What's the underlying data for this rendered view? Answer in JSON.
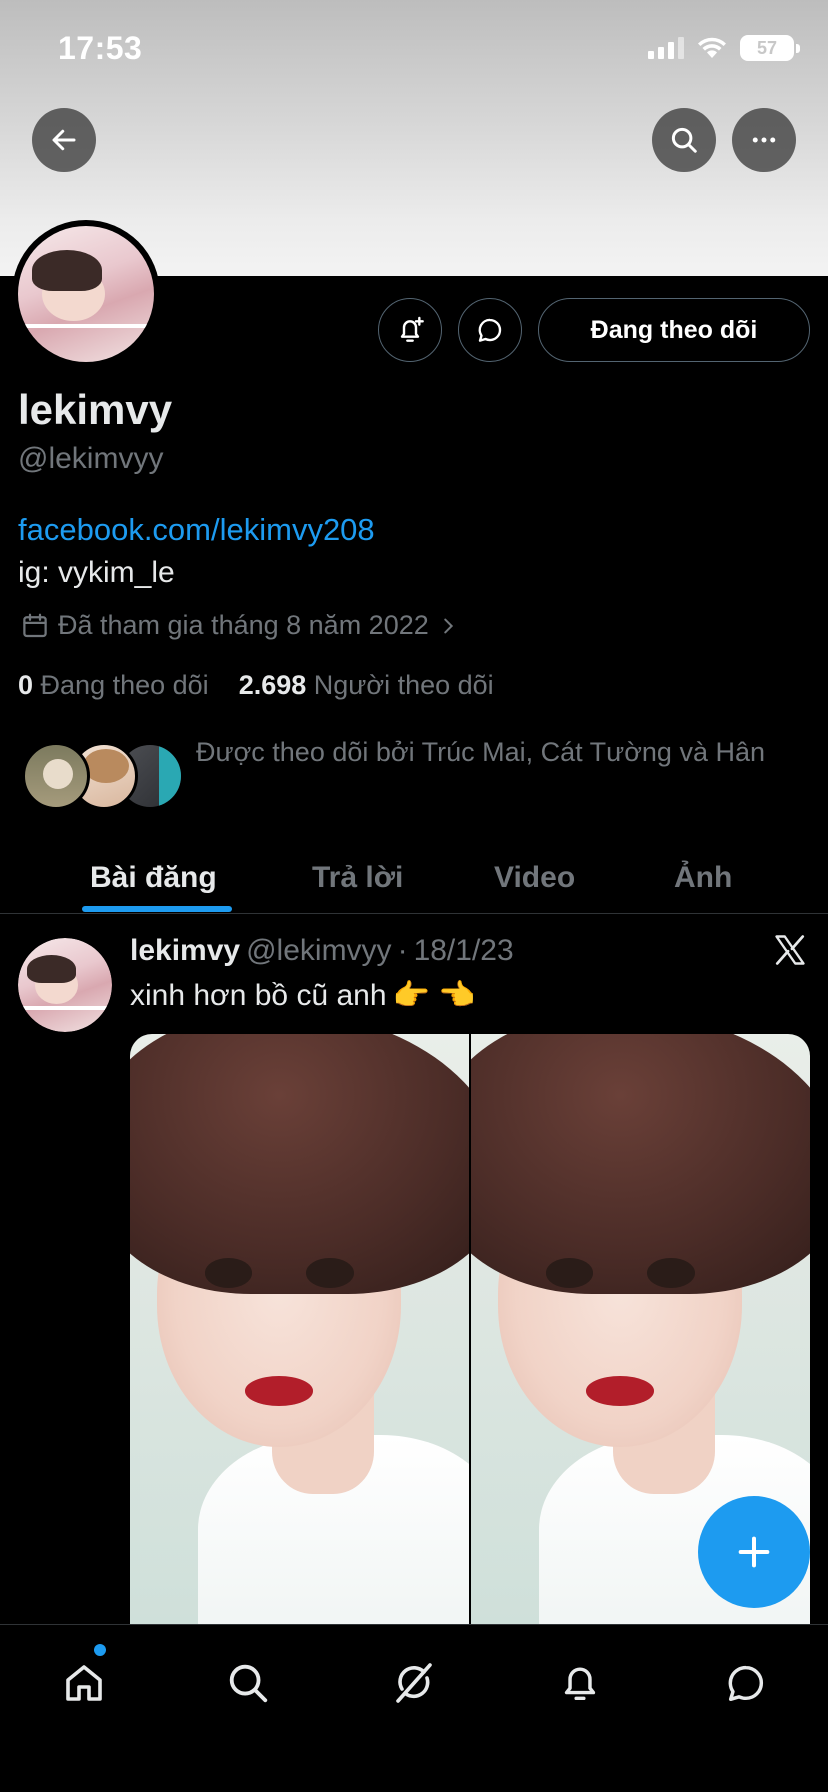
{
  "status_bar": {
    "time": "17:53",
    "battery": "57"
  },
  "profile": {
    "follow_label": "Đang theo dõi",
    "name": "lekimvy",
    "handle": "@lekimvyy",
    "link": "facebook.com/lekimvy208",
    "bio": "ig: vykim_le",
    "joined": "Đã tham gia tháng 8 năm 2022",
    "following_count": "0",
    "following_label": "Đang theo dõi",
    "followers_count": "2.698",
    "followers_label": "Người theo dõi",
    "followed_by": "Được theo dõi bởi Trúc Mai, Cát Tường và Hân"
  },
  "tabs": [
    {
      "label": "Bài đăng",
      "active": true
    },
    {
      "label": "Trả lời",
      "active": false
    },
    {
      "label": "Video",
      "active": false
    },
    {
      "label": "Ảnh",
      "active": false
    }
  ],
  "tweet": {
    "name": "lekimvy",
    "handle": "@lekimvyy",
    "separator": "·",
    "date": "18/1/23",
    "text": "xinh hơn bồ cũ anh",
    "emojis": "👉 👈"
  },
  "icons": {
    "back": "arrow-left-icon",
    "search": "search-icon",
    "more": "more-icon",
    "notify": "bell-plus-icon",
    "message": "message-icon",
    "calendar": "calendar-icon",
    "compose": "plus-icon",
    "nav": [
      "home-icon",
      "search-icon",
      "grok-icon",
      "bell-icon",
      "message-icon"
    ]
  },
  "colors": {
    "accent": "#1d9bf0",
    "background": "#000000",
    "muted": "#71767b"
  }
}
